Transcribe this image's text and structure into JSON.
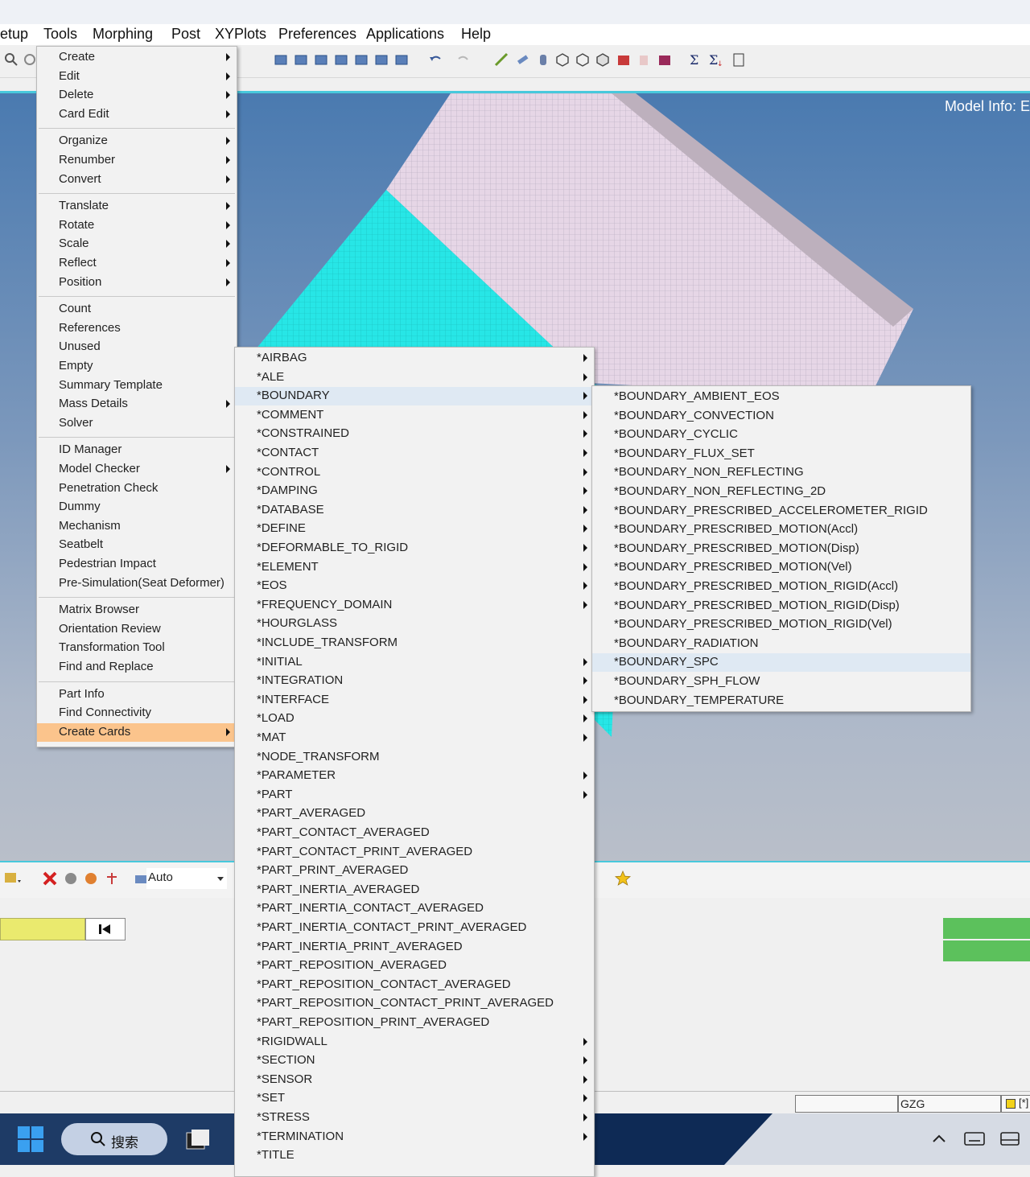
{
  "menubar": {
    "items": [
      "etup",
      "Tools",
      "Morphing",
      "Post",
      "XYPlots",
      "Preferences",
      "Applications",
      "Help"
    ]
  },
  "viewport": {
    "model_info": "Model Info: E"
  },
  "tools_menu": {
    "groups": [
      [
        {
          "label": "Create",
          "submenu": true
        },
        {
          "label": "Edit",
          "submenu": true
        },
        {
          "label": "Delete",
          "submenu": true
        },
        {
          "label": "Card Edit",
          "submenu": true
        }
      ],
      [
        {
          "label": "Organize",
          "submenu": true
        },
        {
          "label": "Renumber",
          "submenu": true
        },
        {
          "label": "Convert",
          "submenu": true
        }
      ],
      [
        {
          "label": "Translate",
          "submenu": true
        },
        {
          "label": "Rotate",
          "submenu": true
        },
        {
          "label": "Scale",
          "submenu": true
        },
        {
          "label": "Reflect",
          "submenu": true
        },
        {
          "label": "Position",
          "submenu": true
        }
      ],
      [
        {
          "label": "Count",
          "submenu": false
        },
        {
          "label": "References",
          "submenu": false
        },
        {
          "label": "Unused",
          "submenu": false
        },
        {
          "label": "Empty",
          "submenu": false
        },
        {
          "label": "Summary Template",
          "submenu": false
        },
        {
          "label": "Mass Details",
          "submenu": true
        },
        {
          "label": "Solver",
          "submenu": false
        }
      ],
      [
        {
          "label": "ID Manager",
          "submenu": false
        },
        {
          "label": "Model Checker",
          "submenu": true
        },
        {
          "label": "Penetration Check",
          "submenu": false
        },
        {
          "label": "Dummy",
          "submenu": false
        },
        {
          "label": "Mechanism",
          "submenu": false
        },
        {
          "label": "Seatbelt",
          "submenu": false
        },
        {
          "label": "Pedestrian Impact",
          "submenu": false
        },
        {
          "label": "Pre-Simulation(Seat Deformer)",
          "submenu": false
        }
      ],
      [
        {
          "label": "Matrix Browser",
          "submenu": false
        },
        {
          "label": "Orientation Review",
          "submenu": false
        },
        {
          "label": "Transformation Tool",
          "submenu": false
        },
        {
          "label": "Find and Replace",
          "submenu": false
        }
      ],
      [
        {
          "label": "Part Info",
          "submenu": false
        },
        {
          "label": "Find Connectivity",
          "submenu": false
        },
        {
          "label": "Create Cards",
          "submenu": true,
          "highlighted": true
        }
      ]
    ]
  },
  "cards_menu": {
    "items": [
      {
        "label": "*AIRBAG",
        "submenu": true
      },
      {
        "label": "*ALE",
        "submenu": true
      },
      {
        "label": "*BOUNDARY",
        "submenu": true,
        "highlighted": true
      },
      {
        "label": "*COMMENT",
        "submenu": true
      },
      {
        "label": "*CONSTRAINED",
        "submenu": true
      },
      {
        "label": "*CONTACT",
        "submenu": true
      },
      {
        "label": "*CONTROL",
        "submenu": true
      },
      {
        "label": "*DAMPING",
        "submenu": true
      },
      {
        "label": "*DATABASE",
        "submenu": true
      },
      {
        "label": "*DEFINE",
        "submenu": true
      },
      {
        "label": "*DEFORMABLE_TO_RIGID",
        "submenu": true
      },
      {
        "label": "*ELEMENT",
        "submenu": true
      },
      {
        "label": "*EOS",
        "submenu": true
      },
      {
        "label": "*FREQUENCY_DOMAIN",
        "submenu": true
      },
      {
        "label": "*HOURGLASS",
        "submenu": false
      },
      {
        "label": "*INCLUDE_TRANSFORM",
        "submenu": false
      },
      {
        "label": "*INITIAL",
        "submenu": true
      },
      {
        "label": "*INTEGRATION",
        "submenu": true
      },
      {
        "label": "*INTERFACE",
        "submenu": true
      },
      {
        "label": "*LOAD",
        "submenu": true
      },
      {
        "label": "*MAT",
        "submenu": true
      },
      {
        "label": "*NODE_TRANSFORM",
        "submenu": false
      },
      {
        "label": "*PARAMETER",
        "submenu": true
      },
      {
        "label": "*PART",
        "submenu": true
      },
      {
        "label": "*PART_AVERAGED",
        "submenu": false
      },
      {
        "label": "*PART_CONTACT_AVERAGED",
        "submenu": false
      },
      {
        "label": "*PART_CONTACT_PRINT_AVERAGED",
        "submenu": false
      },
      {
        "label": "*PART_PRINT_AVERAGED",
        "submenu": false
      },
      {
        "label": "*PART_INERTIA_AVERAGED",
        "submenu": false
      },
      {
        "label": "*PART_INERTIA_CONTACT_AVERAGED",
        "submenu": false
      },
      {
        "label": "*PART_INERTIA_CONTACT_PRINT_AVERAGED",
        "submenu": false
      },
      {
        "label": "*PART_INERTIA_PRINT_AVERAGED",
        "submenu": false
      },
      {
        "label": "*PART_REPOSITION_AVERAGED",
        "submenu": false
      },
      {
        "label": "*PART_REPOSITION_CONTACT_AVERAGED",
        "submenu": false
      },
      {
        "label": "*PART_REPOSITION_CONTACT_PRINT_AVERAGED",
        "submenu": false
      },
      {
        "label": "*PART_REPOSITION_PRINT_AVERAGED",
        "submenu": false
      },
      {
        "label": "*RIGIDWALL",
        "submenu": true
      },
      {
        "label": "*SECTION",
        "submenu": true
      },
      {
        "label": "*SENSOR",
        "submenu": true
      },
      {
        "label": "*SET",
        "submenu": true
      },
      {
        "label": "*STRESS",
        "submenu": true
      },
      {
        "label": "*TERMINATION",
        "submenu": true
      },
      {
        "label": "*TITLE",
        "submenu": false
      }
    ]
  },
  "boundary_menu": {
    "items": [
      {
        "label": "*BOUNDARY_AMBIENT_EOS"
      },
      {
        "label": "*BOUNDARY_CONVECTION"
      },
      {
        "label": "*BOUNDARY_CYCLIC"
      },
      {
        "label": "*BOUNDARY_FLUX_SET"
      },
      {
        "label": "*BOUNDARY_NON_REFLECTING"
      },
      {
        "label": "*BOUNDARY_NON_REFLECTING_2D"
      },
      {
        "label": "*BOUNDARY_PRESCRIBED_ACCELEROMETER_RIGID"
      },
      {
        "label": "*BOUNDARY_PRESCRIBED_MOTION(Accl)"
      },
      {
        "label": "*BOUNDARY_PRESCRIBED_MOTION(Disp)"
      },
      {
        "label": "*BOUNDARY_PRESCRIBED_MOTION(Vel)"
      },
      {
        "label": "*BOUNDARY_PRESCRIBED_MOTION_RIGID(Accl)"
      },
      {
        "label": "*BOUNDARY_PRESCRIBED_MOTION_RIGID(Disp)"
      },
      {
        "label": "*BOUNDARY_PRESCRIBED_MOTION_RIGID(Vel)"
      },
      {
        "label": "*BOUNDARY_RADIATION"
      },
      {
        "label": "*BOUNDARY_SPC",
        "highlighted": true
      },
      {
        "label": "*BOUNDARY_SPH_FLOW"
      },
      {
        "label": "*BOUNDARY_TEMPERATURE"
      }
    ]
  },
  "bottom_toolbar": {
    "select_value": "Auto"
  },
  "statusbar": {
    "field_text": "GZG",
    "indicator_text": "[*]"
  },
  "taskbar": {
    "search_label": "搜索"
  },
  "colors": {
    "menu_highlight": "#fbc48c",
    "submenu_highlight": "#dfe9f3",
    "accent_line": "#48c8dc",
    "mesh_cyan": "#27e6e6",
    "mesh_pink": "#e6d6e6",
    "input_yellow": "#eaea6e",
    "status_green": "#5cc15c"
  },
  "icons": [
    "zoom-icon",
    "undo-icon",
    "redo-icon",
    "sigma-icon",
    "delete-icon",
    "star-icon",
    "first-frame-icon",
    "windows-start-icon",
    "search-icon",
    "chevron-up-icon",
    "keyboard-icon",
    "display-icon"
  ]
}
